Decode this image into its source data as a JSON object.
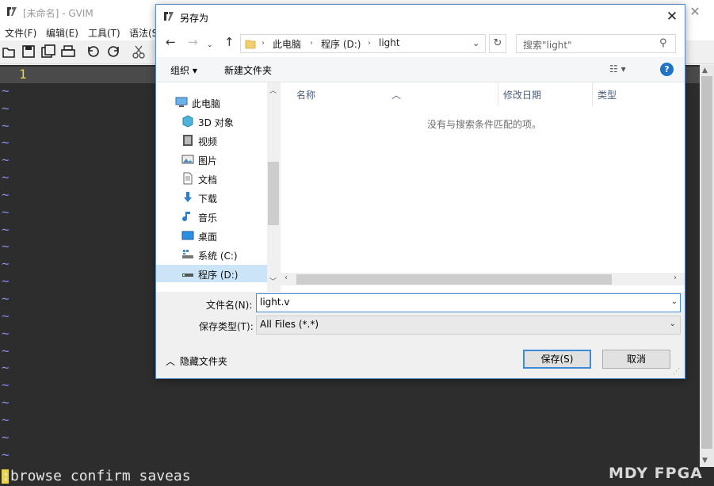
{
  "gvim": {
    "title": "[未命名] - GVIM",
    "menu": [
      "文件(F)",
      "编辑(E)",
      "工具(T)",
      "语法(S)"
    ],
    "line_number": "1",
    "command_text": "browse confirm saveas",
    "cursor_char": ":",
    "tilde": "~",
    "watermark": "MDY FPGA",
    "close_glyph": "✕"
  },
  "dialog": {
    "title": "另存为",
    "close_glyph": "✕",
    "breadcrumb": [
      "此电脑",
      "程序 (D:)",
      "light"
    ],
    "search_placeholder": "搜索\"light\"",
    "toolbar": {
      "organize": "组织 ▾",
      "new_folder": "新建文件夹",
      "view_glyph": "☷ ▾",
      "help_glyph": "?"
    },
    "tree": [
      {
        "label": "此电脑",
        "icon": "computer-icon"
      },
      {
        "label": "3D 对象",
        "icon": "3d-objects-icon"
      },
      {
        "label": "视频",
        "icon": "video-icon"
      },
      {
        "label": "图片",
        "icon": "pictures-icon"
      },
      {
        "label": "文档",
        "icon": "documents-icon"
      },
      {
        "label": "下载",
        "icon": "download-icon"
      },
      {
        "label": "音乐",
        "icon": "music-icon"
      },
      {
        "label": "桌面",
        "icon": "desktop-icon"
      },
      {
        "label": "系统 (C:)",
        "icon": "drive-c-icon"
      },
      {
        "label": "程序 (D:)",
        "icon": "drive-d-icon",
        "selected": true
      }
    ],
    "columns": [
      "名称",
      "修改日期",
      "类型"
    ],
    "empty_message": "没有与搜索条件匹配的项。",
    "filename_label": "文件名(N):",
    "filename_value": "light.v",
    "filetype_label": "保存类型(T):",
    "filetype_value": "All Files (*.*)",
    "hide_folders": "隐藏文件夹",
    "save_button": "保存(S)",
    "cancel_button": "取消"
  },
  "colors": {
    "editor_bg": "#2d2d2d",
    "tilde": "#8a8ae6",
    "line_number": "#e8d44d",
    "accent": "#3c8ad8"
  }
}
